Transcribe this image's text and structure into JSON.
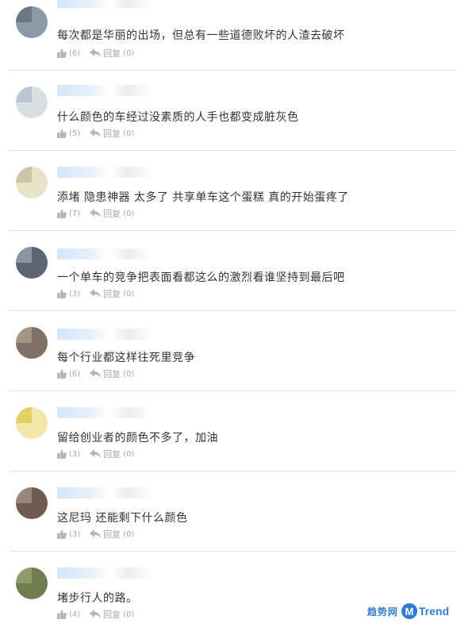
{
  "comments": [
    {
      "text": "每次都是华丽的出场，但总有一些道德败坏的人渣去破坏",
      "likes": "(6)",
      "reply_label": "回复",
      "replies": "(0)"
    },
    {
      "text": "什么颜色的车经过没素质的人手也都变成脏灰色",
      "likes": "(5)",
      "reply_label": "回复",
      "replies": "(0)"
    },
    {
      "text": "添堵  隐患神器  太多了  共享单车这个蛋糕  真的开始蛋疼了",
      "likes": "(7)",
      "reply_label": "回复",
      "replies": "(0)"
    },
    {
      "text": "一个单车的竞争把表面看都这么的激烈看谁坚持到最后吧",
      "likes": "(3)",
      "reply_label": "回复",
      "replies": "(0)"
    },
    {
      "text": "每个行业都这样往死里竞争",
      "likes": "(6)",
      "reply_label": "回复",
      "replies": "(0)"
    },
    {
      "text": "留给创业者的颜色不多了，加油",
      "likes": "(3)",
      "reply_label": "回复",
      "replies": "(0)"
    },
    {
      "text": "这尼玛  还能剩下什么颜色",
      "likes": "(3)",
      "reply_label": "回复",
      "replies": "(0)"
    },
    {
      "text": "堵步行人的路。",
      "likes": "(4)",
      "reply_label": "回复",
      "replies": "(0)"
    }
  ],
  "watermark": {
    "cn": "趋势网",
    "logo": "M",
    "en": "Trend"
  },
  "icons": {
    "like": "thumbs-up-icon",
    "reply": "reply-arrow-icon"
  },
  "colors": {
    "text": "#333333",
    "meta": "#a8a8a8",
    "divider": "#e2e2e2",
    "watermark": "#2f7fcf"
  }
}
